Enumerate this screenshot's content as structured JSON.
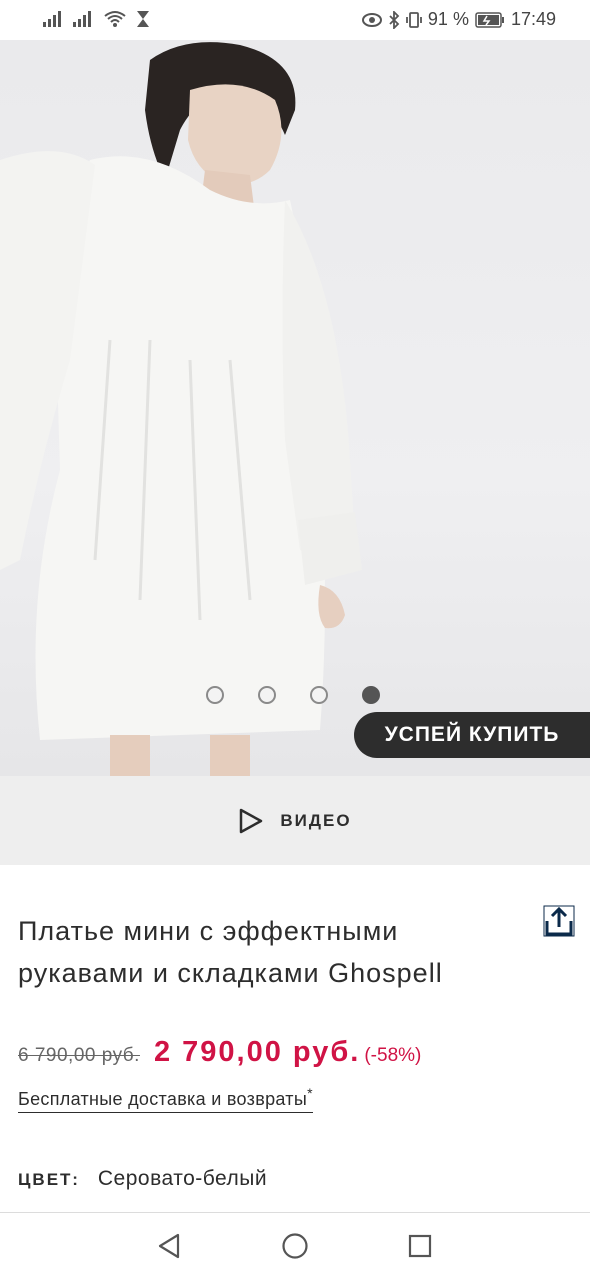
{
  "status_bar": {
    "battery": "91 %",
    "time": "17:49"
  },
  "carousel": {
    "slide_count": 4,
    "active_slide": 4
  },
  "promo_badge": "УСПЕЙ КУПИТЬ",
  "video_label": "ВИДЕО",
  "product": {
    "title": "Платье мини с эффектными рукавами и складками Ghospell",
    "old_price": "6 790,00 руб.",
    "new_price": "2 790,00 руб.",
    "discount": "(-58%)",
    "delivery_text": "Бесплатные доставка и возвраты",
    "delivery_mark": "*",
    "color_label": "ЦВЕТ:",
    "color_value": "Серовато-белый"
  },
  "colors": {
    "accent": "#d01345",
    "dark": "#2d2d2d",
    "video_bar_bg": "#eeeeee"
  },
  "icons": {
    "share": "share-icon",
    "play": "play-icon",
    "nav_back": "back-triangle-icon",
    "nav_home": "home-circle-icon",
    "nav_recents": "recents-square-icon"
  }
}
